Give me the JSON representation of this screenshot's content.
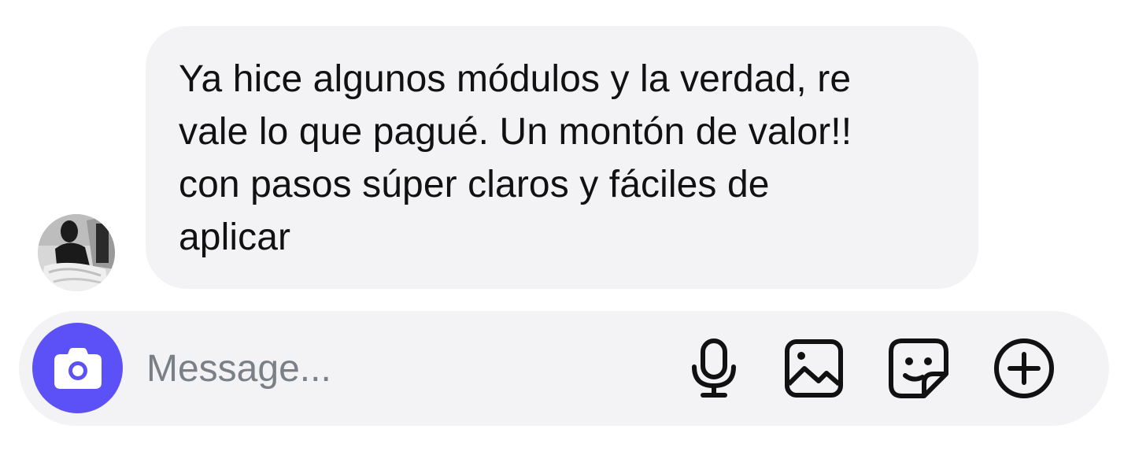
{
  "conversation": {
    "incoming_message": {
      "sender_avatar_icon": "avatar",
      "lines": [
        "Ya hice algunos módulos y la verdad, re",
        "vale lo que pagué. Un montón de valor!!",
        "con pasos súper claros y fáciles de",
        "aplicar"
      ]
    }
  },
  "composer": {
    "placeholder": "Message...",
    "value": "",
    "camera_icon": "camera-icon",
    "actions": [
      {
        "icon": "microphone-icon"
      },
      {
        "icon": "image-gallery-icon"
      },
      {
        "icon": "sticker-icon"
      },
      {
        "icon": "plus-circle-icon"
      }
    ]
  },
  "colors": {
    "accent": "#5b51f7",
    "bubble_background": "#f3f3f5",
    "text": "#111111",
    "placeholder": "#7b7f86"
  }
}
